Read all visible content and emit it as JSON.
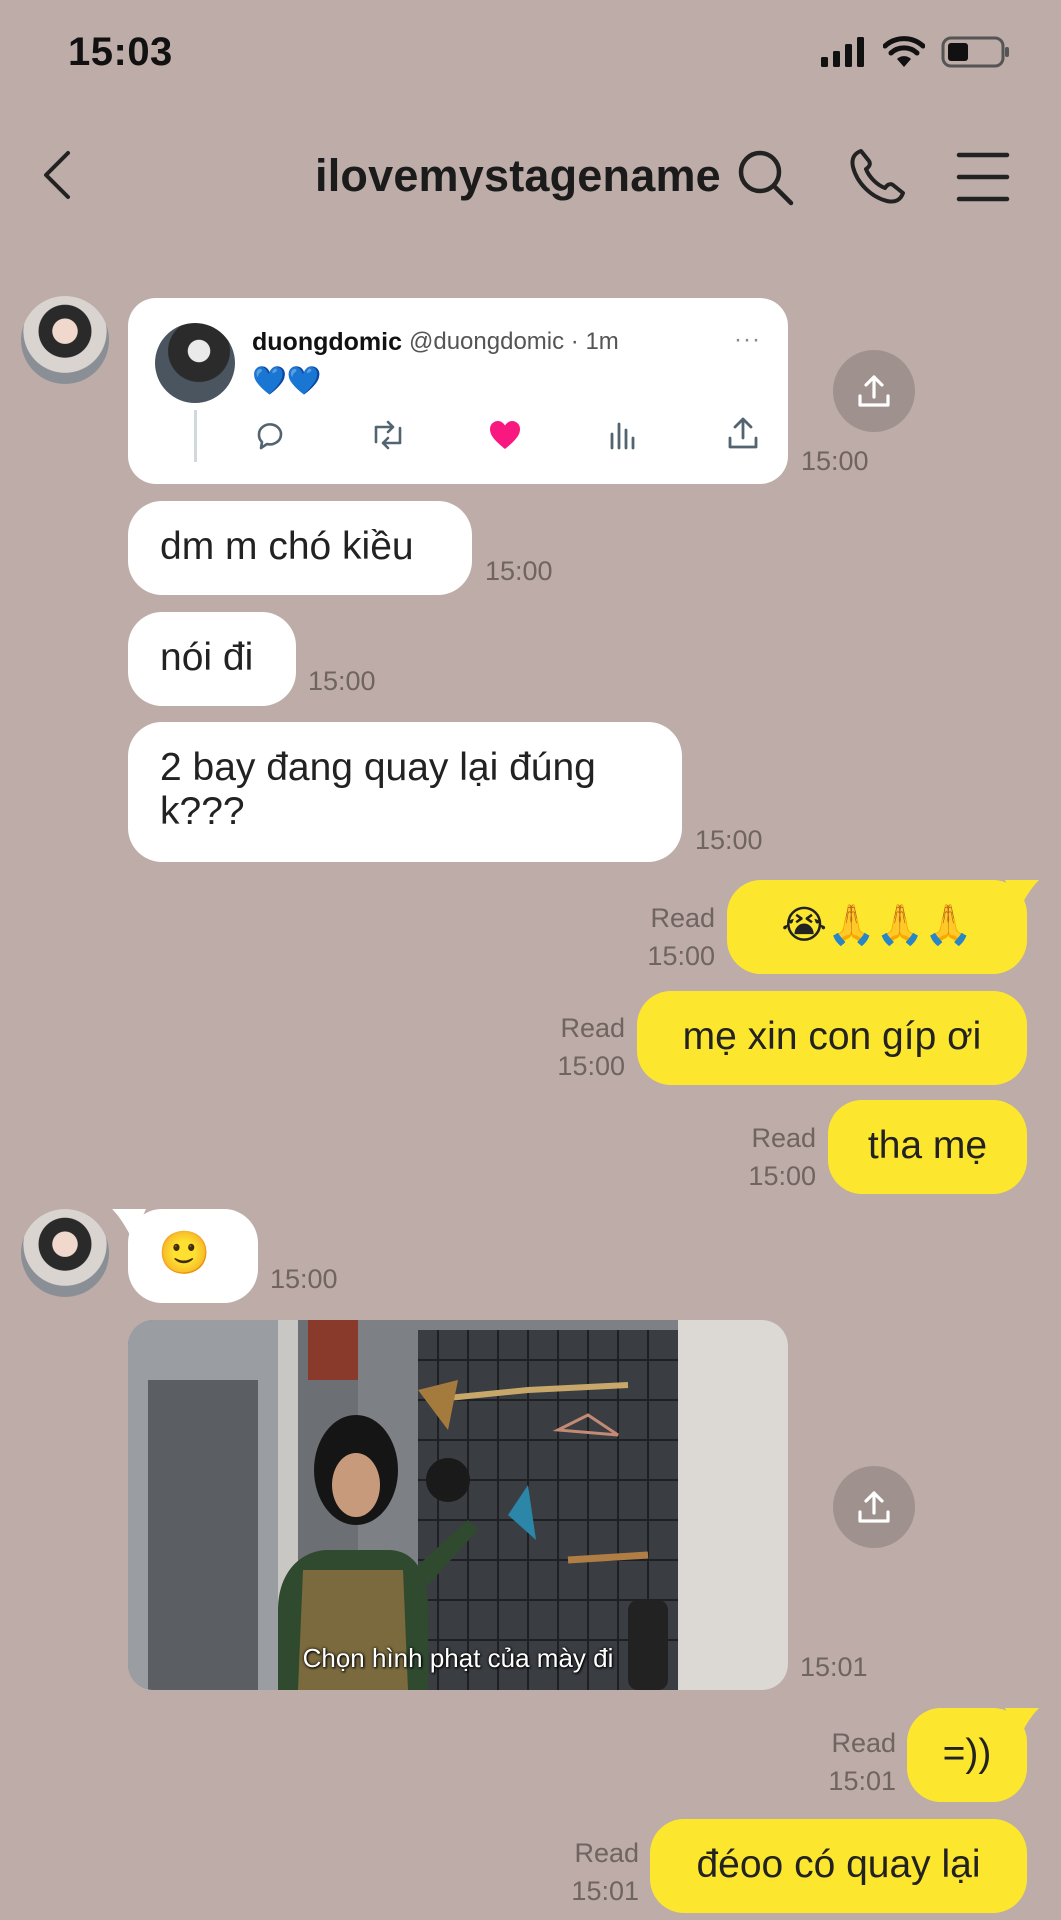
{
  "status": {
    "time": "15:03"
  },
  "header": {
    "title": "ilovemystagename"
  },
  "tweet": {
    "name": "duongdomic",
    "handle": "@duongdomic · 1m",
    "more": "···",
    "text": "💙💙",
    "time": "15:00"
  },
  "messages": [
    {
      "id": "m1",
      "text": "dm m chó kiều",
      "time": "15:00"
    },
    {
      "id": "m2",
      "text": "nói đi",
      "time": "15:00"
    },
    {
      "id": "m3",
      "text": "2 bay đang quay lại đúng k???",
      "time": "15:00"
    },
    {
      "id": "m4",
      "text": "😭🙏🙏🙏",
      "read": "Read",
      "time": "15:00"
    },
    {
      "id": "m5",
      "text": "mẹ xin con gíp ơi",
      "read": "Read",
      "time": "15:00"
    },
    {
      "id": "m6",
      "text": "tha mẹ",
      "read": "Read",
      "time": "15:00"
    },
    {
      "id": "m7",
      "text": "🙂",
      "time": "15:00"
    },
    {
      "id": "m8",
      "caption": "Chọn hình phạt của mày đi",
      "time": "15:01"
    },
    {
      "id": "m9",
      "text": "=))",
      "read": "Read",
      "time": "15:01"
    },
    {
      "id": "m10",
      "text": "đéoo có quay lại",
      "read": "Read",
      "time": "15:01"
    }
  ],
  "colors": {
    "background": "#bdaca7",
    "outgoing": "#fde72e",
    "incoming": "#ffffff",
    "like": "#f91880"
  }
}
